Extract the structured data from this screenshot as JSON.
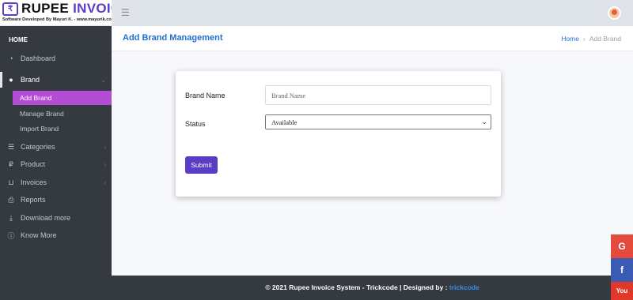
{
  "app": {
    "logo_mark": "₹",
    "logo_word1": "RUPEE",
    "logo_word2": "INVOICE",
    "tagline": "Software Developed By Mayuri K. - www.mayurik.com"
  },
  "header": {
    "menu_icon": "☰"
  },
  "sidebar": {
    "header": "HOME",
    "items": [
      {
        "label": "Dashboard",
        "icon": "dashboard-icon"
      },
      {
        "label": "Brand",
        "icon": "apple-icon",
        "open": true,
        "children": [
          {
            "label": "Add Brand",
            "active": true
          },
          {
            "label": "Manage Brand"
          },
          {
            "label": "Import Brand"
          }
        ]
      },
      {
        "label": "Categories",
        "icon": "list-icon"
      },
      {
        "label": "Product",
        "icon": "rupee-icon"
      },
      {
        "label": "Invoices",
        "icon": "cart-icon"
      },
      {
        "label": "Reports",
        "icon": "print-icon"
      },
      {
        "label": "Download more",
        "icon": "download-icon"
      },
      {
        "label": "Know More",
        "icon": "info-icon"
      }
    ]
  },
  "page": {
    "title": "Add Brand Management",
    "breadcrumb": {
      "home": "Home",
      "current": "Add Brand"
    }
  },
  "form": {
    "brand_name_label": "Brand Name",
    "brand_name_placeholder": "Brand Name",
    "brand_name_value": "",
    "status_label": "Status",
    "status_value": "Available",
    "submit_label": "Submit"
  },
  "footer": {
    "text": "© 2021 Rupee Invoice System - Trickcode | Designed by :",
    "link": "trickcode"
  },
  "social": {
    "google": "G",
    "facebook": "f",
    "youtube": "You"
  },
  "colors": {
    "accent": "#5b3cc4",
    "active_item": "#b44dd6",
    "sidebar_bg": "#343a40",
    "title_blue": "#1f6fd6",
    "google": "#e54b3c",
    "facebook": "#3b5bb5",
    "youtube": "#e0392b"
  }
}
